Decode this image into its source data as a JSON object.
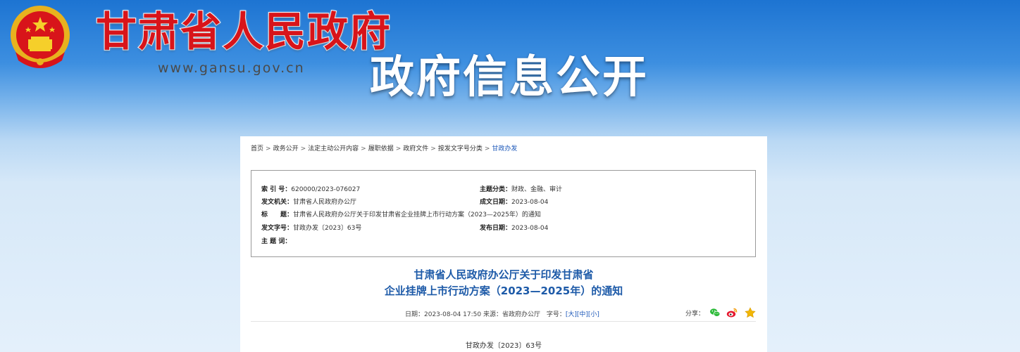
{
  "header": {
    "site_title": "甘肃省人民政府",
    "site_url": "www.gansu.gov.cn",
    "section_title": "政府信息公开"
  },
  "breadcrumb": [
    "首页",
    "政务公开",
    "法定主动公开内容",
    "履职依据",
    "政府文件",
    "按发文字号分类",
    "甘政办发"
  ],
  "breadcrumb_separator": ">",
  "meta": {
    "index_label": "索 引 号：",
    "index_value": "620000/2023-076027",
    "theme_label": "主题分类：",
    "theme_value": "财政、金融、审计",
    "issuer_label": "发文机关：",
    "issuer_value": "甘肃省人民政府办公厅",
    "created_label": "成文日期：",
    "created_value": "2023-08-04",
    "title_label": "标　　题：",
    "title_value": "甘肃省人民政府办公厅关于印发甘肃省企业挂牌上市行动方案（2023—2025年）的通知",
    "docno_label": "发文字号：",
    "docno_value": "甘政办发〔2023〕63号",
    "published_label": "发布日期：",
    "published_value": "2023-08-04",
    "keywords_label": "主 题 词：",
    "keywords_value": ""
  },
  "document": {
    "title_line1": "甘肃省人民政府办公厅关于印发甘肃省",
    "title_line2": "企业挂牌上市行动方案（2023—2025年）的通知",
    "date_source": "日期：2023-08-04 17:50 来源：省政府办公厅",
    "font_size_label": "字号：",
    "font_large": "[大]",
    "font_medium": "[中]",
    "font_small": "[小]",
    "share_label": "分享：",
    "doc_number": "甘政办发〔2023〕63号"
  },
  "icons": {
    "emblem": "national-emblem-icon",
    "wechat": "wechat-icon",
    "weibo": "weibo-icon",
    "favorite": "star-icon"
  },
  "colors": {
    "title_red": "#d8141a",
    "doc_title_blue": "#1d5aa8",
    "link_blue": "#1a56b8",
    "wechat_green": "#2dbb3a",
    "weibo_red": "#e6162d",
    "star_gold": "#f2b705"
  }
}
